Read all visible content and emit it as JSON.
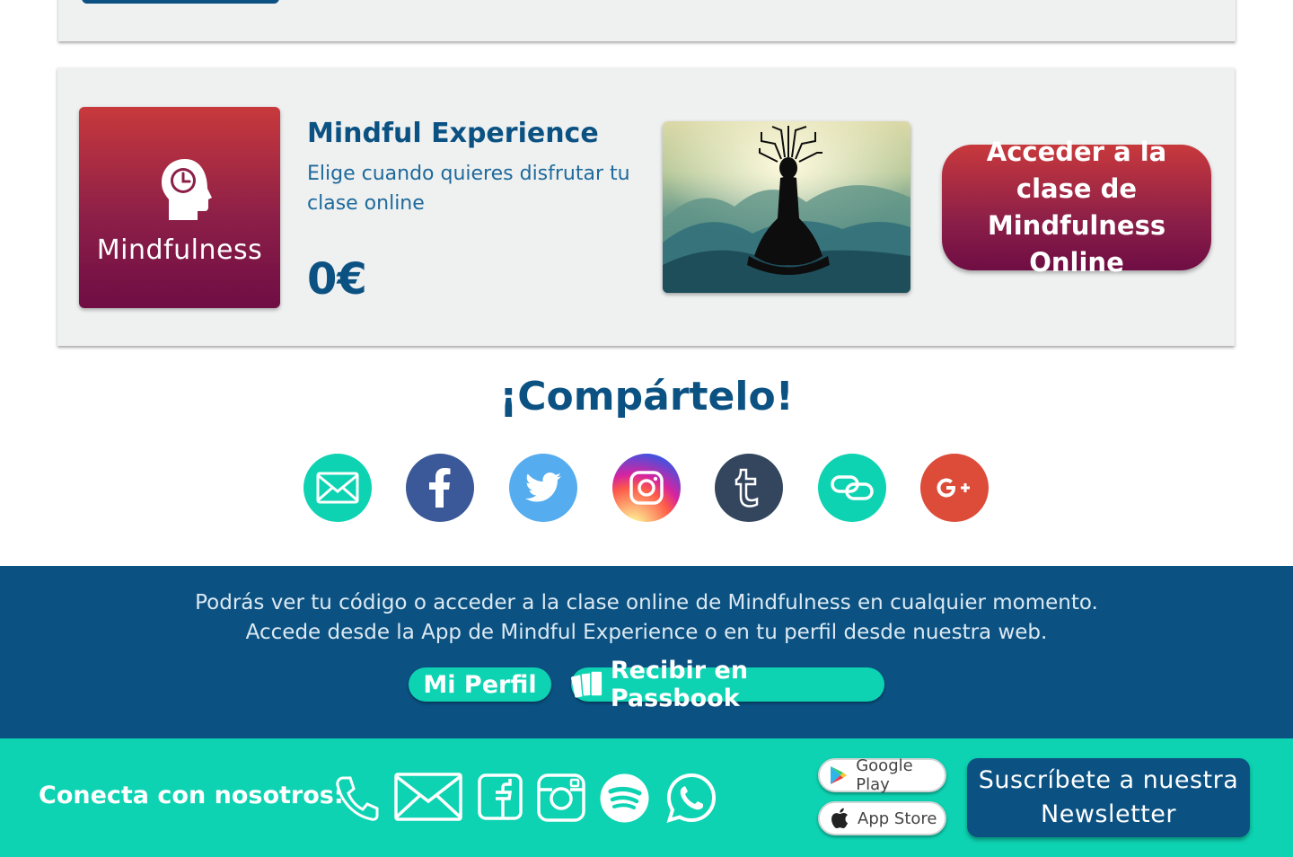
{
  "product": {
    "tile_label": "Mindfulness",
    "title": "Mindful Experience",
    "description": "Elige cuando quieres disfrutar tu clase online",
    "price": "0€",
    "cta_label": "Acceder a la clase de Mindfulness Online"
  },
  "share": {
    "title": "¡Compártelo!",
    "buttons": [
      {
        "name": "email-icon",
        "color": "#0dd3b2"
      },
      {
        "name": "facebook-icon",
        "color": "#3b5998"
      },
      {
        "name": "twitter-icon",
        "color": "#55acee"
      },
      {
        "name": "instagram-icon",
        "color": "#d62976"
      },
      {
        "name": "tumblr-icon",
        "color": "#34465d"
      },
      {
        "name": "link-icon",
        "color": "#0dd3b2"
      },
      {
        "name": "google-plus-icon",
        "color": "#dd4b39"
      }
    ]
  },
  "info": {
    "line1": "Podrás ver tu código o acceder a la clase online de Mindfulness  en cualquier momento.",
    "line2": "Accede desde la  App de Mindful Experience o en tu perfil desde nuestra web.",
    "profile_button": "Mi Perfil",
    "passbook_button": "Recibir en Passbook"
  },
  "footer": {
    "connect_label": "Conecta con nosotros:",
    "google_play": "Google Play",
    "app_store": "App Store",
    "newsletter_button": "Suscríbete a nuestra Newsletter"
  },
  "colors": {
    "navy": "#0b5283",
    "teal": "#0dd3b2",
    "crimson": "#c8393c",
    "plum": "#6f0d44"
  }
}
